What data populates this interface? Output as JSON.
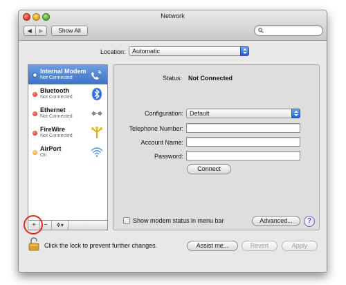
{
  "window": {
    "title": "Network"
  },
  "toolbar": {
    "back_glyph": "◀",
    "forward_glyph": "▶",
    "show_all_label": "Show All",
    "search_placeholder": ""
  },
  "location": {
    "label": "Location:",
    "value": "Automatic"
  },
  "services": [
    {
      "name": "Internal Modem",
      "status": "Not Connected",
      "status_color": "#3a6fd8",
      "icon": "phone-icon",
      "selected": true
    },
    {
      "name": "Bluetooth",
      "status": "Not Connected",
      "status_color": "#d0291c",
      "icon": "bluetooth-icon",
      "selected": false
    },
    {
      "name": "Ethernet",
      "status": "Not Connected",
      "status_color": "#d0291c",
      "icon": "ethernet-icon",
      "selected": false
    },
    {
      "name": "FireWire",
      "status": "Not Connected",
      "status_color": "#d0291c",
      "icon": "firewire-icon",
      "selected": false
    },
    {
      "name": "AirPort",
      "status": "On",
      "status_color": "#e6a617",
      "icon": "wifi-icon",
      "selected": false
    }
  ],
  "sidebar_tools": {
    "add": "+",
    "remove": "−",
    "gear": "✲▾"
  },
  "detail": {
    "status_label": "Status:",
    "status_value": "Not Connected",
    "configuration_label": "Configuration:",
    "configuration_value": "Default",
    "telephone_label": "Telephone Number:",
    "telephone_value": "",
    "account_label": "Account Name:",
    "account_value": "",
    "password_label": "Password:",
    "password_value": "",
    "connect_label": "Connect",
    "show_modem_label": "Show modem status in menu bar",
    "advanced_label": "Advanced...",
    "help_glyph": "?"
  },
  "footer": {
    "lock_text": "Click the lock to prevent further changes.",
    "assist_label": "Assist me...",
    "revert_label": "Revert",
    "apply_label": "Apply"
  },
  "colors": {
    "selection": "#4a7ecf",
    "annotation_circle": "#d92b1a"
  }
}
